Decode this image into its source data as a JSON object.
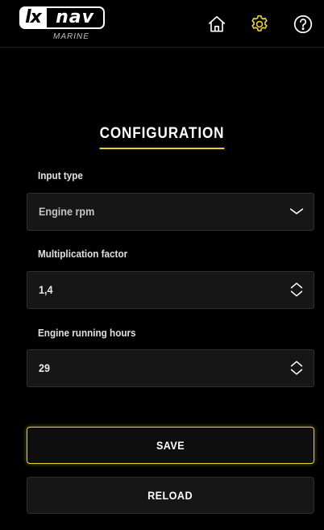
{
  "header": {
    "logo": {
      "brand_left": "lx",
      "brand_right": "nav",
      "subtitle": "MARINE"
    },
    "icons": [
      {
        "name": "home-icon",
        "active": false
      },
      {
        "name": "gear-icon",
        "active": true
      },
      {
        "name": "help-icon",
        "active": false
      }
    ]
  },
  "config": {
    "title": "CONFIGURATION",
    "fields": [
      {
        "label": "Input type",
        "value": "Engine rpm",
        "control": "dropdown"
      },
      {
        "label": "Multiplication factor",
        "value": "1,4",
        "control": "stepper"
      },
      {
        "label": "Engine running hours",
        "value": "29",
        "control": "stepper"
      }
    ]
  },
  "actions": {
    "save_label": "SAVE",
    "reload_label": "RELOAD"
  },
  "colors": {
    "accent": "#e7d22a",
    "background": "#000000",
    "field_background": "#161616",
    "text": "#ffffff"
  }
}
